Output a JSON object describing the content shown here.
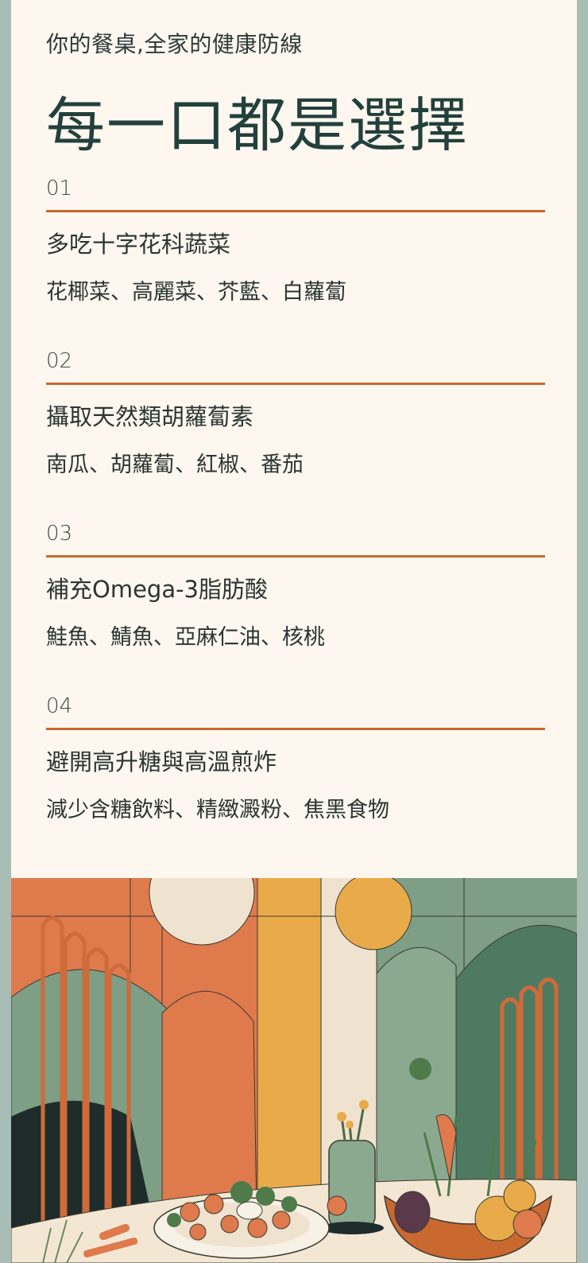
{
  "header": {
    "subtitle": "你的餐桌,全家的健康防線",
    "title": "每一口都是選擇"
  },
  "items": [
    {
      "number": "01",
      "heading": "多吃十字花科蔬菜",
      "detail": "花椰菜、高麗菜、芥藍、白蘿蔔"
    },
    {
      "number": "02",
      "heading": "攝取天然類胡蘿蔔素",
      "detail": "南瓜、胡蘿蔔、紅椒、番茄"
    },
    {
      "number": "03",
      "heading": "補充Omega-3脂肪酸",
      "detail": "鮭魚、鯖魚、亞麻仁油、核桃"
    },
    {
      "number": "04",
      "heading": "避開高升糖與高溫煎炸",
      "detail": "減少含糖飲料、精緻澱粉、焦黑食物"
    }
  ],
  "colors": {
    "accent": "#c9692f",
    "background": "#fdf7ef",
    "title": "#22403c",
    "sage": "#7e9e85",
    "orange": "#df7a4d",
    "mustard": "#e9ab4a"
  }
}
